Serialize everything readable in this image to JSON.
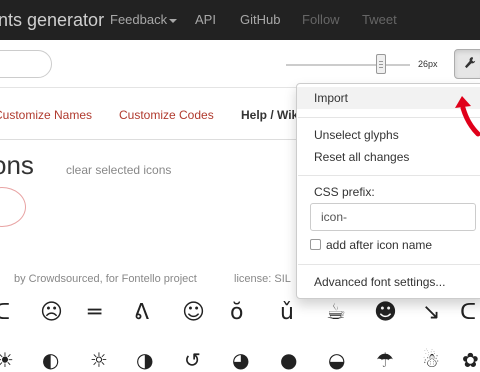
{
  "navbar": {
    "brand": "nts generator",
    "links": [
      "Feedback",
      "API",
      "GitHub",
      "Follow",
      "Tweet"
    ]
  },
  "toolbar": {
    "glyph_size": "26px",
    "glyph_size_slider_fraction": 0.76,
    "settings_icon": "wrench-icon"
  },
  "tabs": [
    "Customize Names",
    "Customize Codes",
    "Help / Wiki"
  ],
  "section": {
    "title": "ons",
    "clear_link": "clear selected icons"
  },
  "font_info": {
    "by": "by Crowdsourced, for Fontello project",
    "license": "license: SIL"
  },
  "glyphs_row1": [
    "ᑕ",
    "☹",
    "═",
    "ᕕ",
    "☺",
    "ŏ",
    "ǔ",
    "☕",
    "☻",
    "↘",
    "ᑕ"
  ],
  "glyphs_row2": [
    "☀",
    "◐",
    "☼",
    "◑",
    "↺",
    "◕",
    "●",
    "◒",
    "☂",
    "☃",
    "✿"
  ],
  "menu": {
    "import": "Import",
    "unselect": "Unselect glyphs",
    "reset": "Reset all changes",
    "css_prefix_label": "CSS prefix:",
    "css_prefix_value": "icon-",
    "add_after_label": "add after icon name",
    "add_after_checked": false,
    "advanced": "Advanced font settings..."
  },
  "colors": {
    "navbar_bg": "#222222",
    "tab_link": "#b03a2e",
    "annotation_arrow": "#e0001a"
  }
}
